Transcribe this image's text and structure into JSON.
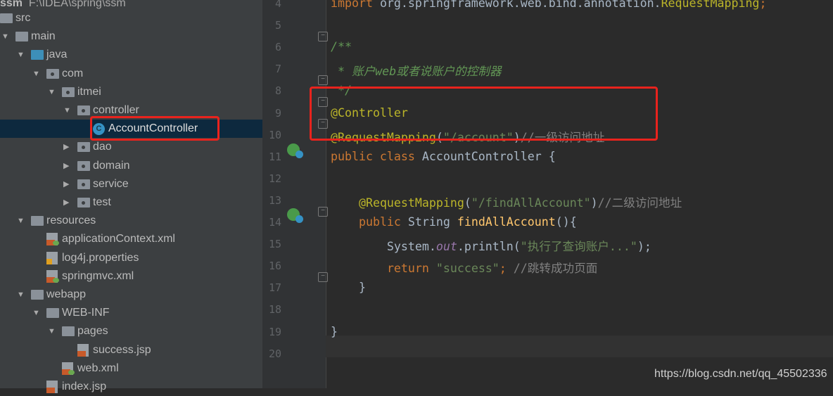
{
  "project_header": {
    "name": "ssm",
    "path": "F:\\IDEA\\spring\\ssm"
  },
  "tree": [
    {
      "label": "src",
      "depth": 0,
      "type": "folder",
      "arrow": ""
    },
    {
      "label": "main",
      "depth": 0,
      "type": "folder",
      "arrow": "open"
    },
    {
      "label": "java",
      "depth": 1,
      "type": "folder-blue",
      "arrow": "open"
    },
    {
      "label": "com",
      "depth": 2,
      "type": "package",
      "arrow": "open"
    },
    {
      "label": "itmei",
      "depth": 3,
      "type": "package",
      "arrow": "open"
    },
    {
      "label": "controller",
      "depth": 4,
      "type": "package",
      "arrow": "open"
    },
    {
      "label": "AccountController",
      "depth": 5,
      "type": "class",
      "arrow": "",
      "selected": true
    },
    {
      "label": "dao",
      "depth": 4,
      "type": "package",
      "arrow": "closed"
    },
    {
      "label": "domain",
      "depth": 4,
      "type": "package",
      "arrow": "closed"
    },
    {
      "label": "service",
      "depth": 4,
      "type": "package",
      "arrow": "closed"
    },
    {
      "label": "test",
      "depth": 4,
      "type": "package",
      "arrow": "closed"
    },
    {
      "label": "resources",
      "depth": 1,
      "type": "folder",
      "arrow": "open"
    },
    {
      "label": "applicationContext.xml",
      "depth": 2,
      "type": "xml",
      "arrow": ""
    },
    {
      "label": "log4j.properties",
      "depth": 2,
      "type": "properties",
      "arrow": ""
    },
    {
      "label": "springmvc.xml",
      "depth": 2,
      "type": "xml",
      "arrow": ""
    },
    {
      "label": "webapp",
      "depth": 1,
      "type": "folder",
      "arrow": "open"
    },
    {
      "label": "WEB-INF",
      "depth": 2,
      "type": "folder",
      "arrow": "open"
    },
    {
      "label": "pages",
      "depth": 3,
      "type": "folder",
      "arrow": "open"
    },
    {
      "label": "success.jsp",
      "depth": 4,
      "type": "jsp",
      "arrow": ""
    },
    {
      "label": "web.xml",
      "depth": 3,
      "type": "xml",
      "arrow": ""
    },
    {
      "label": "index.jsp",
      "depth": 2,
      "type": "jsp",
      "arrow": ""
    }
  ],
  "colors": {
    "keyword": "#cc7832",
    "annotation": "#bbb529",
    "string": "#6a8759",
    "doc": "#629755",
    "comment": "#808080",
    "field": "#9876aa",
    "method": "#ffc66d",
    "text": "#a9b7c6",
    "highlight": "#e8231d"
  },
  "code": [
    {
      "n": "4",
      "t": [
        [
          "keyword",
          "import "
        ],
        [
          "text",
          "org.springframework.web.bind.annotation."
        ],
        [
          "annotation",
          "RequestMapping"
        ],
        [
          "keyword",
          ";"
        ]
      ]
    },
    {
      "n": "5",
      "t": []
    },
    {
      "n": "6",
      "t": [
        [
          "doc",
          "/**"
        ]
      ]
    },
    {
      "n": "7",
      "t": [
        [
          "doc",
          " * 账户web或者说账户的控制器"
        ]
      ]
    },
    {
      "n": "8",
      "t": [
        [
          "doc",
          " */"
        ]
      ]
    },
    {
      "n": "9",
      "t": [
        [
          "annotation",
          "@Controller"
        ]
      ]
    },
    {
      "n": "10",
      "t": [
        [
          "annotation",
          "@RequestMapping"
        ],
        [
          "text",
          "("
        ],
        [
          "string",
          "\"/account\""
        ],
        [
          "text",
          ")"
        ],
        [
          "comment",
          "//一级访问地址"
        ]
      ]
    },
    {
      "n": "11",
      "t": [
        [
          "keyword",
          "public class "
        ],
        [
          "text",
          "AccountController {"
        ]
      ]
    },
    {
      "n": "12",
      "t": []
    },
    {
      "n": "13",
      "t": [
        [
          "text",
          "    "
        ],
        [
          "annotation",
          "@RequestMapping"
        ],
        [
          "text",
          "("
        ],
        [
          "string",
          "\"/findAllAccount\""
        ],
        [
          "text",
          ")"
        ],
        [
          "comment",
          "//二级访问地址"
        ]
      ]
    },
    {
      "n": "14",
      "t": [
        [
          "text",
          "    "
        ],
        [
          "keyword",
          "public "
        ],
        [
          "text",
          "String "
        ],
        [
          "method",
          "findAllAccount"
        ],
        [
          "text",
          "(){"
        ]
      ]
    },
    {
      "n": "15",
      "t": [
        [
          "text",
          "        System."
        ],
        [
          "field",
          "out"
        ],
        [
          "text",
          ".println("
        ],
        [
          "string",
          "\"执行了查询账户...\""
        ],
        [
          "text",
          ");"
        ]
      ]
    },
    {
      "n": "16",
      "t": [
        [
          "text",
          "        "
        ],
        [
          "keyword",
          "return "
        ],
        [
          "string",
          "\"success\""
        ],
        [
          "keyword",
          "; "
        ],
        [
          "comment",
          "//跳转成功页面"
        ]
      ]
    },
    {
      "n": "17",
      "t": [
        [
          "text",
          "    }"
        ]
      ]
    },
    {
      "n": "18",
      "t": []
    },
    {
      "n": "19",
      "t": [
        [
          "text",
          "}"
        ]
      ]
    },
    {
      "n": "20",
      "t": []
    }
  ],
  "watermark": "https://blog.csdn.net/qq_45502336"
}
